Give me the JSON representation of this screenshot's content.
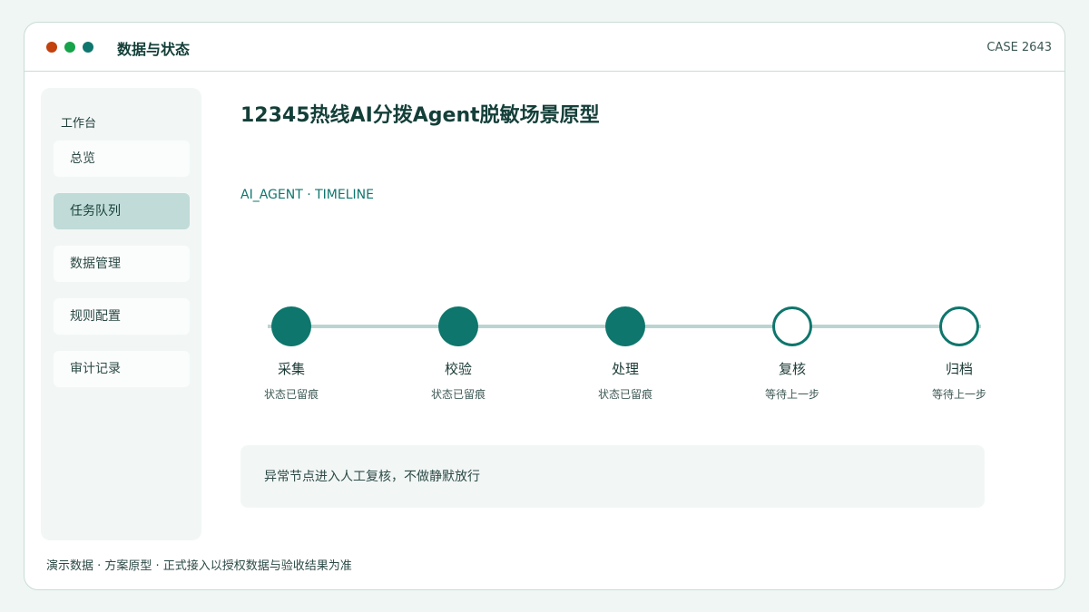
{
  "window": {
    "title": "数据与状态",
    "case_id": "CASE 2643",
    "controls": {
      "colors": {
        "red": "#c2410c",
        "green": "#16a34a",
        "teal": "#0f766e"
      }
    }
  },
  "sidebar": {
    "heading": "工作台",
    "items": [
      {
        "label": "总览",
        "active": false
      },
      {
        "label": "任务队列",
        "active": true
      },
      {
        "label": "数据管理",
        "active": false
      },
      {
        "label": "规则配置",
        "active": false
      },
      {
        "label": "审计记录",
        "active": false
      }
    ]
  },
  "main": {
    "title": "12345热线AI分拨Agent脱敏场景原型",
    "subtitle": "AI_AGENT · TIMELINE",
    "timeline": {
      "steps": [
        {
          "label": "采集",
          "status": "状态已留痕",
          "state": "done"
        },
        {
          "label": "校验",
          "status": "状态已留痕",
          "state": "done"
        },
        {
          "label": "处理",
          "status": "状态已留痕",
          "state": "done"
        },
        {
          "label": "复核",
          "status": "等待上一步",
          "state": "pending"
        },
        {
          "label": "归档",
          "status": "等待上一步",
          "state": "pending"
        }
      ]
    },
    "notice": "异常节点进入人工复核，不做静默放行"
  },
  "footer": "演示数据 · 方案原型 · 正式接入以授权数据与验收结果为准",
  "colors": {
    "accent": "#0e766c",
    "track": "#bcd4d0",
    "active_nav": "#c0dbd8",
    "panel": "#f2f7f6"
  }
}
